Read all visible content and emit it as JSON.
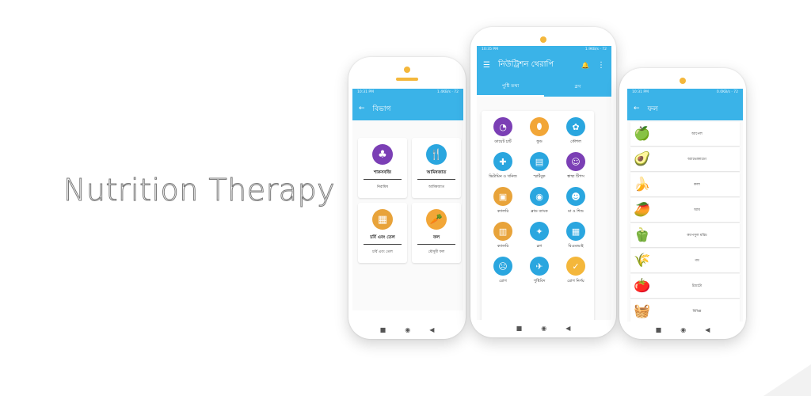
{
  "tagline": "Nutrition Therapy",
  "phone_categories": {
    "status_time": "10:31 PM",
    "status_right": "1.4KB/s",
    "battery": "72",
    "title": "বিভাগ",
    "back_icon": "arrow-left-icon",
    "categories": [
      {
        "title": "শাকসবজি",
        "subtitle": "নিরামিষ",
        "icon": "vegetable-icon",
        "color": "#7b3fb5"
      },
      {
        "title": "আমিষজাত",
        "subtitle": "আমিষজাত",
        "icon": "fork-knife-icon",
        "color": "#2aa6df"
      },
      {
        "title": "চর্বি এবং তেল",
        "subtitle": "চর্বি এবং তেল",
        "icon": "oil-icon",
        "color": "#e8a33a"
      },
      {
        "title": "ফল",
        "subtitle": "মৌসুমী ফল",
        "icon": "fruit-icon",
        "color": "#f2a637"
      }
    ]
  },
  "phone_main": {
    "status_time": "10:35 PM",
    "status_right": "1.9KB/s",
    "battery": "72",
    "title": "নিউট্রিশন থেরাপি",
    "tabs": [
      "পুষ্টি তথ্য",
      "ব্লগ"
    ],
    "items": [
      {
        "label": "ডায়েট চার্ট",
        "icon": "diet-chart-icon",
        "color": "#7b3fb5",
        "glyph": "◔"
      },
      {
        "label": "ফুড",
        "icon": "food-icon",
        "color": "#f2a637",
        "glyph": "⬮"
      },
      {
        "label": "কৌশল",
        "icon": "technique-icon",
        "color": "#2aa6df",
        "glyph": "✿"
      },
      {
        "label": "ভিটামিন ও খনিজ",
        "icon": "vitamin-icon",
        "color": "#2aa6df",
        "glyph": "✚"
      },
      {
        "label": "স্মার্টবুক",
        "icon": "smartbook-icon",
        "color": "#2aa6df",
        "glyph": "▤"
      },
      {
        "label": "স্বাস্থ্য টিপস",
        "icon": "health-tips-icon",
        "color": "#7b3fb5",
        "glyph": "☺"
      },
      {
        "label": "ক্যালরি",
        "icon": "calorie-icon",
        "color": "#e8a33a",
        "glyph": "▣"
      },
      {
        "label": "ব্লাড ব্যাংক",
        "icon": "blood-bank-icon",
        "color": "#2aa6df",
        "glyph": "◉"
      },
      {
        "label": "মা ও শিশু",
        "icon": "mother-child-icon",
        "color": "#2aa6df",
        "glyph": "☻"
      },
      {
        "label": "ক্যালরি",
        "icon": "calorie-book-icon",
        "color": "#e8a33a",
        "glyph": "▥"
      },
      {
        "label": "ব্লগ",
        "icon": "blog-icon",
        "color": "#2aa6df",
        "glyph": "✦"
      },
      {
        "label": "বিএমআই",
        "icon": "bmi-icon",
        "color": "#2aa6df",
        "glyph": "▦"
      },
      {
        "label": "রোগ",
        "icon": "disease-icon",
        "color": "#2aa6df",
        "glyph": "☹"
      },
      {
        "label": "পুষ্টিবিদ",
        "icon": "nutritionist-icon",
        "color": "#2aa6df",
        "glyph": "✈"
      },
      {
        "label": "রোগ নির্ণয়",
        "icon": "diagnosis-icon",
        "color": "#f4b73b",
        "glyph": "✓"
      }
    ]
  },
  "phone_fruits": {
    "status_time": "10:31 PM",
    "status_right": "0.0KB/s",
    "battery": "72",
    "title": "ফল",
    "fruits": [
      {
        "name": "আপেল",
        "icon": "apple-icon",
        "glyph": "🍏"
      },
      {
        "name": "অ্যাভোকাডো",
        "icon": "avocado-icon",
        "glyph": "🥑"
      },
      {
        "name": "কলা",
        "icon": "banana-icon",
        "glyph": "🍌"
      },
      {
        "name": "আম",
        "icon": "mango-icon",
        "glyph": "🥭"
      },
      {
        "name": "ক্যাপসুল মরিচ",
        "icon": "pepper-icon",
        "glyph": "🫑"
      },
      {
        "name": "গম",
        "icon": "wheat-icon",
        "glyph": "🌾"
      },
      {
        "name": "টমেটো",
        "icon": "tomato-icon",
        "glyph": "🍅"
      },
      {
        "name": "বিভিন্ন",
        "icon": "mixed-icon",
        "glyph": "🧺"
      }
    ]
  },
  "nav": {
    "square": "■",
    "circle": "◉",
    "back": "◀"
  }
}
